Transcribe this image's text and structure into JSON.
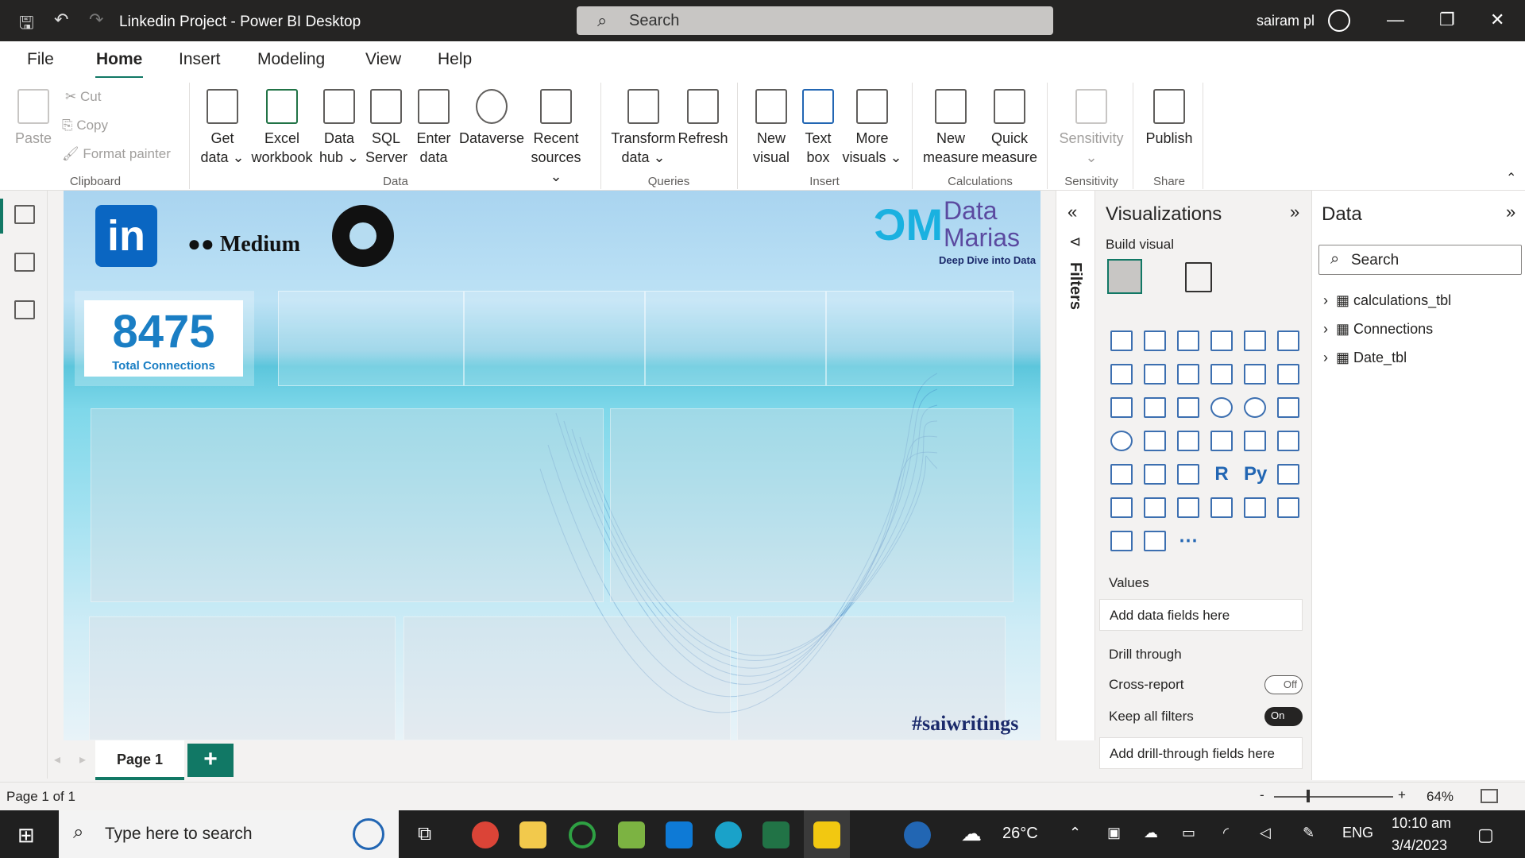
{
  "window": {
    "title": "Linkedin Project - Power BI Desktop",
    "search_placeholder": "Search",
    "user": "sairam pl"
  },
  "menu": {
    "items": [
      "File",
      "Home",
      "Insert",
      "Modeling",
      "View",
      "Help"
    ]
  },
  "ribbon": {
    "clipboard": {
      "paste": "Paste",
      "cut": "Cut",
      "copy": "Copy",
      "format_painter": "Format painter",
      "group": "Clipboard"
    },
    "data": {
      "get_data": "Get data ⌄",
      "excel": "Excel workbook",
      "data_hub": "Data hub ⌄",
      "sql": "SQL Server",
      "enter": "Enter data",
      "dataverse": "Dataverse",
      "recent": "Recent sources ⌄",
      "group": "Data"
    },
    "queries": {
      "transform": "Transform data ⌄",
      "refresh": "Refresh",
      "group": "Queries"
    },
    "insert": {
      "new_visual": "New visual",
      "text_box": "Text box",
      "more": "More visuals ⌄",
      "group": "Insert"
    },
    "calculations": {
      "new_measure": "New measure",
      "quick_measure": "Quick measure",
      "group": "Calculations"
    },
    "sensitivity": {
      "label": "Sensitivity ⌄",
      "group": "Sensitivity"
    },
    "share": {
      "publish": "Publish",
      "group": "Share"
    }
  },
  "canvas": {
    "medium": "●● Medium",
    "brand_line1": "Data",
    "brand_line2": "Marias",
    "brand_tagline": "Deep Dive into Data",
    "kpi_value": "8475",
    "kpi_label": "Total Connections",
    "hashtag": "#saiwritings",
    "linkedin": "in"
  },
  "pages": {
    "tab": "Page 1",
    "add": "+"
  },
  "filters": {
    "label": "Filters"
  },
  "visualizations": {
    "title": "Visualizations",
    "build": "Build visual",
    "values": "Values",
    "values_placeholder": "Add data fields here",
    "drill": "Drill through",
    "cross": "Cross-report",
    "cross_state": "Off",
    "keep": "Keep all filters",
    "keep_state": "On",
    "drill_placeholder": "Add drill-through fields here",
    "r_label": "R",
    "py_label": "Py"
  },
  "data_pane": {
    "title": "Data",
    "search": "Search",
    "tables": [
      "calculations_tbl",
      "Connections",
      "Date_tbl"
    ]
  },
  "status": {
    "page": "Page 1 of 1",
    "zoom": "64%"
  },
  "taskbar": {
    "search": "Type here to search",
    "temp": "26°C",
    "lang": "ENG",
    "time": "10:10 am",
    "date": "3/4/2023"
  }
}
